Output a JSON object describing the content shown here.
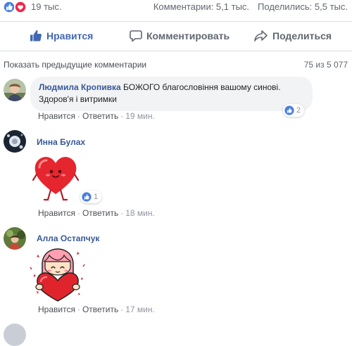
{
  "reactions": {
    "count": "19 тыс.",
    "icons": [
      "like-icon",
      "love-icon"
    ]
  },
  "stats": {
    "comments": "Комментарии: 5,1 тыс.",
    "shares": "Поделились: 5,5 тыс."
  },
  "actions": {
    "like": "Нравится",
    "comment": "Комментировать",
    "share": "Поделиться"
  },
  "comments_header": {
    "previous": "Показать предыдущие комментарии",
    "counter": "75 из 5 077"
  },
  "comments": [
    {
      "author": "Людмила Кропивка",
      "text": "БОЖОГО благословіння вашому синові. Здоров'я і витримки",
      "like": "Нравится",
      "reply": "Ответить",
      "time": "19 мин.",
      "reaction_count": "2"
    },
    {
      "author": "Инна Булах",
      "sticker": "heart-sticker",
      "like": "Нравится",
      "reply": "Ответить",
      "time": "18 мин.",
      "reaction_count": "1"
    },
    {
      "author": "Алла Остапчук",
      "sticker": "girl-hugging-heart-sticker",
      "like": "Нравится",
      "reply": "Ответить",
      "time": "17 мин."
    }
  ],
  "colors": {
    "brand": "#4267b2",
    "author": "#385898",
    "bubble": "#f2f3f5",
    "muted": "#606770"
  }
}
